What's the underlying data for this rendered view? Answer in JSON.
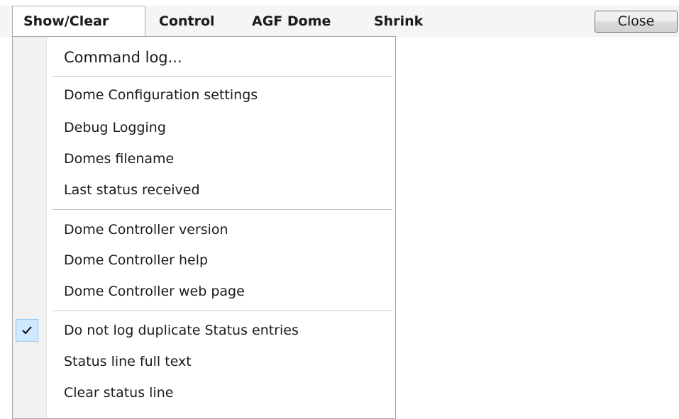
{
  "menubar": {
    "menus": [
      {
        "label": "Show/Clear",
        "open": true
      },
      {
        "label": "Control"
      },
      {
        "label": "AGF Dome"
      },
      {
        "label": "Shrink"
      }
    ],
    "close_label": "Close"
  },
  "dropdown": {
    "items": [
      {
        "label": "Command log..."
      },
      {
        "label": "Dome Configuration settings"
      },
      {
        "label": "Debug Logging"
      },
      {
        "label": "Domes filename"
      },
      {
        "label": "Last status received"
      },
      {
        "label": "Dome Controller version"
      },
      {
        "label": "Dome Controller help"
      },
      {
        "label": "Dome Controller web page"
      },
      {
        "label": "Do not log duplicate Status entries",
        "checked": true
      },
      {
        "label": "Status line full text"
      },
      {
        "label": "Clear status line"
      }
    ],
    "check_icon": "checkmark-icon"
  }
}
